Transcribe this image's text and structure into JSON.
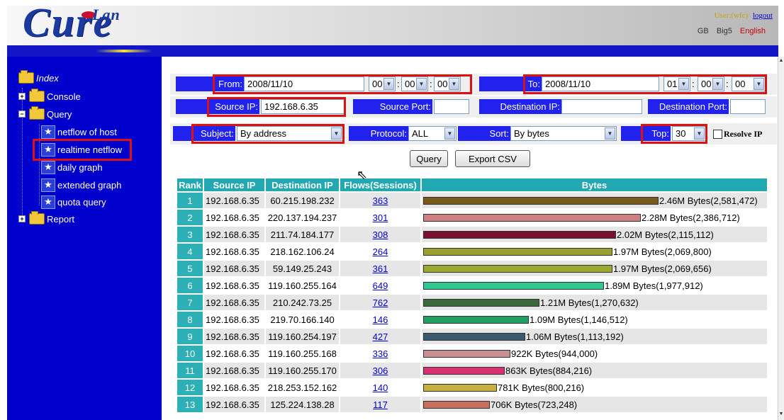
{
  "header": {
    "logo_lan": "Lan",
    "logo_cure": "Cure",
    "user_label": "User:(wfc)",
    "logout_label": "logout",
    "languages": [
      "GB",
      "Big5",
      "English"
    ],
    "active_language": "English"
  },
  "sidebar": {
    "root": "Index",
    "console": "Console",
    "query": "Query",
    "query_items": [
      "netflow of host",
      "realtime netflow",
      "daily graph",
      "extended graph",
      "quota query"
    ],
    "selected_item": "realtime netflow",
    "report": "Report"
  },
  "form": {
    "from_label": "From:",
    "from_date": "2008/11/10",
    "from_hour": "00",
    "from_min": "00",
    "from_sec": "00",
    "to_label": "To:",
    "to_date": "2008/11/10",
    "to_hour": "01",
    "to_min": "00",
    "to_sec": "00",
    "source_ip_label": "Source IP:",
    "source_ip": "192.168.6.35",
    "source_port_label": "Source Port:",
    "source_port": "",
    "dest_ip_label": "Destination IP:",
    "dest_ip": "",
    "dest_port_label": "Destination Port:",
    "dest_port": "",
    "subject_label": "Subject:",
    "subject_value": "By address",
    "protocol_label": "Protocol:",
    "protocol_value": "ALL",
    "sort_label": "Sort:",
    "sort_value": "By bytes",
    "top_label": "Top:",
    "top_value": "30",
    "resolve_ip_label": "Resolve IP",
    "query_button": "Query",
    "export_button": "Export CSV"
  },
  "table": {
    "headers": [
      "Rank",
      "Source IP",
      "Destination IP",
      "Flows(Sessions)",
      "Bytes"
    ],
    "rows": [
      {
        "rank": "1",
        "src": "192.168.6.35",
        "dst": "60.215.198.232",
        "flows": "363",
        "bytes": "2.46M Bytes(2,581,472)",
        "ratio": 1.0,
        "color": "#7a5a1c"
      },
      {
        "rank": "2",
        "src": "192.168.6.35",
        "dst": "220.137.194.237",
        "flows": "301",
        "bytes": "2.28M Bytes(2,386,712)",
        "ratio": 0.925,
        "color": "#d08080"
      },
      {
        "rank": "3",
        "src": "192.168.6.35",
        "dst": "211.74.184.177",
        "flows": "308",
        "bytes": "2.02M Bytes(2,115,112)",
        "ratio": 0.819,
        "color": "#7a1030"
      },
      {
        "rank": "4",
        "src": "192.168.6.35",
        "dst": "218.162.106.24",
        "flows": "264",
        "bytes": "1.97M Bytes(2,069,800)",
        "ratio": 0.802,
        "color": "#9aa030"
      },
      {
        "rank": "5",
        "src": "192.168.6.35",
        "dst": "59.149.25.243",
        "flows": "361",
        "bytes": "1.97M Bytes(2,069,656)",
        "ratio": 0.802,
        "color": "#9aa830"
      },
      {
        "rank": "6",
        "src": "192.168.6.35",
        "dst": "119.160.255.164",
        "flows": "649",
        "bytes": "1.89M Bytes(1,977,912)",
        "ratio": 0.766,
        "color": "#30c890"
      },
      {
        "rank": "7",
        "src": "192.168.6.35",
        "dst": "210.242.73.25",
        "flows": "762",
        "bytes": "1.21M Bytes(1,270,632)",
        "ratio": 0.492,
        "color": "#3a6a3a"
      },
      {
        "rank": "8",
        "src": "192.168.6.35",
        "dst": "219.70.166.140",
        "flows": "146",
        "bytes": "1.09M Bytes(1,146,512)",
        "ratio": 0.444,
        "color": "#20a060"
      },
      {
        "rank": "9",
        "src": "192.168.6.35",
        "dst": "119.160.254.197",
        "flows": "427",
        "bytes": "1.06M Bytes(1,113,192)",
        "ratio": 0.431,
        "color": "#3a5a70"
      },
      {
        "rank": "10",
        "src": "192.168.6.35",
        "dst": "119.160.255.168",
        "flows": "336",
        "bytes": "922K Bytes(944,000)",
        "ratio": 0.366,
        "color": "#c89090"
      },
      {
        "rank": "11",
        "src": "192.168.6.35",
        "dst": "119.160.255.170",
        "flows": "306",
        "bytes": "863K Bytes(884,216)",
        "ratio": 0.342,
        "color": "#d83070"
      },
      {
        "rank": "12",
        "src": "192.168.6.35",
        "dst": "218.253.152.162",
        "flows": "140",
        "bytes": "781K Bytes(800,216)",
        "ratio": 0.31,
        "color": "#c8b040"
      },
      {
        "rank": "13",
        "src": "192.168.6.35",
        "dst": "125.224.138.28",
        "flows": "117",
        "bytes": "706K Bytes(723,248)",
        "ratio": 0.28,
        "color": "#c87060"
      }
    ]
  }
}
